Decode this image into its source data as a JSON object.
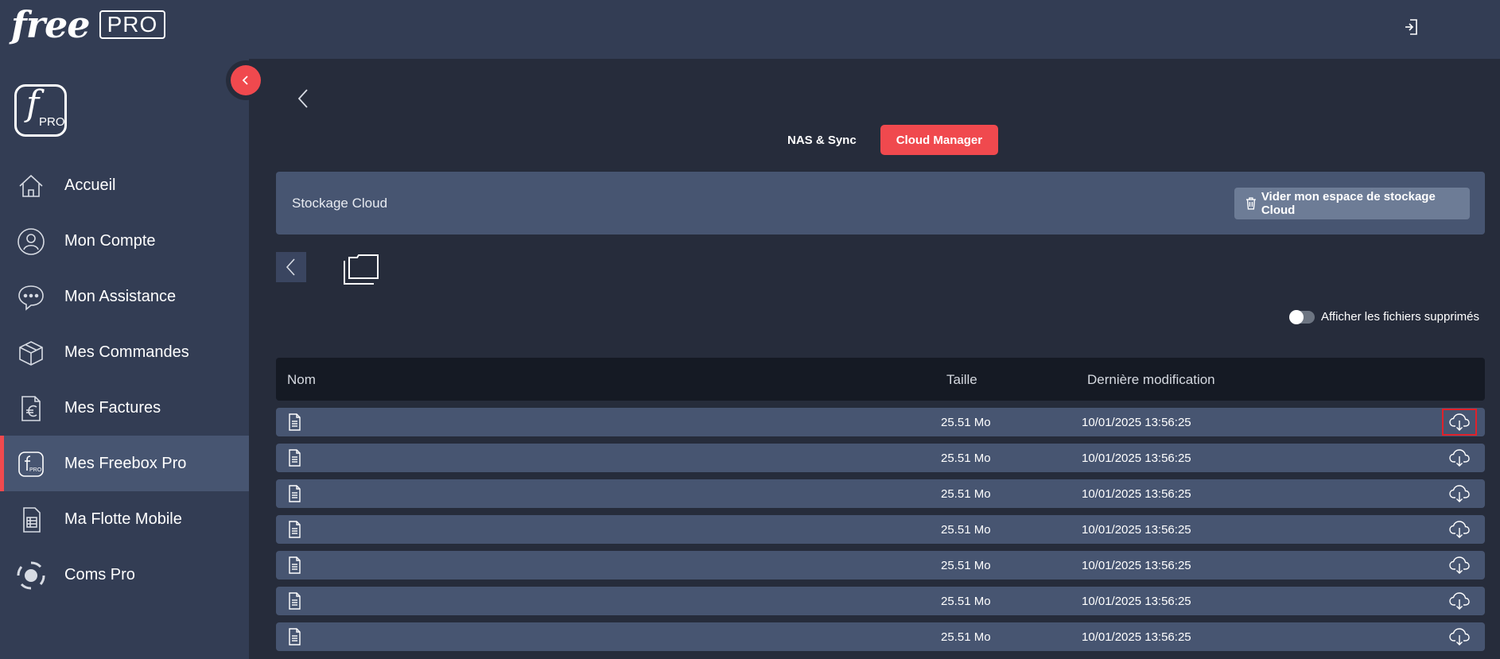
{
  "header": {
    "brand_free": "free",
    "brand_pro": "PRO",
    "logout_icon": "logout-icon"
  },
  "sidebar": {
    "logo_letter": "f",
    "logo_pro": "PRO",
    "items": [
      {
        "label": "Accueil",
        "icon": "home-icon",
        "active": false
      },
      {
        "label": "Mon Compte",
        "icon": "user-icon",
        "active": false
      },
      {
        "label": "Mon Assistance",
        "icon": "chat-icon",
        "active": false
      },
      {
        "label": "Mes Commandes",
        "icon": "box-icon",
        "active": false
      },
      {
        "label": "Mes Factures",
        "icon": "invoice-icon",
        "active": false
      },
      {
        "label": "Mes Freebox Pro",
        "icon": "freebox-icon",
        "active": true
      },
      {
        "label": "Ma Flotte Mobile",
        "icon": "sim-icon",
        "active": false
      },
      {
        "label": "Coms Pro",
        "icon": "coms-icon",
        "active": false
      }
    ]
  },
  "tabs": [
    {
      "label": "NAS & Sync",
      "active": false
    },
    {
      "label": "Cloud Manager",
      "active": true
    }
  ],
  "panel": {
    "title": "Stockage Cloud",
    "empty_button": "Vider mon espace de stockage Cloud"
  },
  "toggle": {
    "label": "Afficher les fichiers supprimés",
    "checked": false
  },
  "table": {
    "headers": {
      "name": "Nom",
      "size": "Taille",
      "modified": "Dernière modification"
    },
    "rows": [
      {
        "name": "",
        "size": "25.51 Mo",
        "modified": "10/01/2025 13:56:25"
      },
      {
        "name": "",
        "size": "25.51 Mo",
        "modified": "10/01/2025 13:56:25"
      },
      {
        "name": "",
        "size": "25.51 Mo",
        "modified": "10/01/2025 13:56:25"
      },
      {
        "name": "",
        "size": "25.51 Mo",
        "modified": "10/01/2025 13:56:25"
      },
      {
        "name": "",
        "size": "25.51 Mo",
        "modified": "10/01/2025 13:56:25"
      },
      {
        "name": "",
        "size": "25.51 Mo",
        "modified": "10/01/2025 13:56:25"
      },
      {
        "name": "",
        "size": "25.51 Mo",
        "modified": "10/01/2025 13:56:25"
      }
    ]
  },
  "colors": {
    "accent": "#f0494e",
    "sidebar_bg": "#333d54",
    "content_bg": "#262c3b",
    "row_bg": "#475571"
  }
}
